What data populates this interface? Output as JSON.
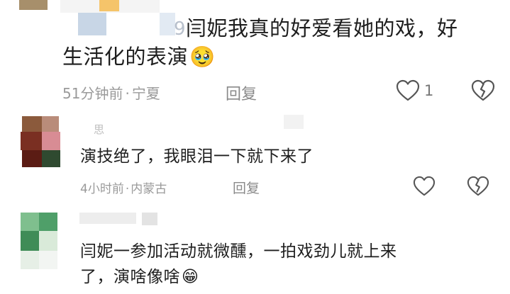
{
  "comments": [
    {
      "name_partial": "9",
      "text_line1": "闫妮我真的好爱看她的戏，好",
      "text_line2": "生活化的表演",
      "emoji": "🥹",
      "time": "51分钟前",
      "separator": "·",
      "location": "宁夏",
      "reply_label": "回复",
      "like_count": "1"
    },
    {
      "name_partial": "思",
      "text_line1": "演技绝了，我眼泪一下就下来了",
      "time": "4小时前",
      "separator": "·",
      "location": "内蒙古",
      "reply_label": "回复"
    },
    {
      "text_line1": "闫妮一参加活动就微醺，一拍戏劲儿就上来",
      "text_line2": "了，演啥像啥",
      "emoji": "😁"
    }
  ]
}
